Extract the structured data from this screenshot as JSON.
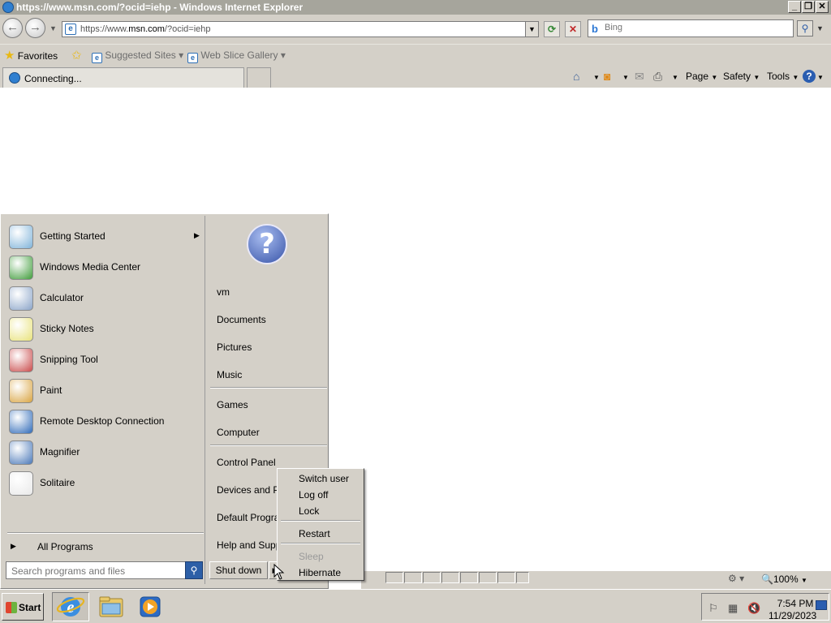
{
  "window": {
    "title": "https://www.msn.com/?ocid=iehp - Windows Internet Explorer",
    "min_label": "_",
    "restore_label": "❐",
    "close_label": "✕"
  },
  "nav": {
    "back_glyph": "←",
    "forward_glyph": "→",
    "address_prefix": "https://www.",
    "address_domain": "msn.com",
    "address_suffix": "/?ocid=iehp",
    "refresh_glyph": "⟳",
    "stop_glyph": "✕",
    "search_placeholder": "Bing",
    "search_logo": "b"
  },
  "favorites_bar": {
    "favorites_label": "Favorites",
    "items": [
      {
        "label": "Suggested Sites ▾"
      },
      {
        "label": "Web Slice Gallery ▾"
      }
    ]
  },
  "tabs": {
    "active_label": "Connecting..."
  },
  "command_bar": {
    "page_label": "Page",
    "safety_label": "Safety",
    "tools_label": "Tools",
    "help_glyph": "?"
  },
  "status_bar": {
    "zoom_label": "100%"
  },
  "start_menu": {
    "programs": [
      {
        "label": "Getting Started",
        "icon": "getting-started-icon",
        "color": "#7fb3d9",
        "has_submenu": true
      },
      {
        "label": "Windows Media Center",
        "icon": "windows-media-center-icon",
        "color": "#3f9c3a"
      },
      {
        "label": "Calculator",
        "icon": "calculator-icon",
        "color": "#8aa4c8"
      },
      {
        "label": "Sticky Notes",
        "icon": "sticky-notes-icon",
        "color": "#e8e27a"
      },
      {
        "label": "Snipping Tool",
        "icon": "snipping-tool-icon",
        "color": "#c94a4a"
      },
      {
        "label": "Paint",
        "icon": "paint-icon",
        "color": "#d9a441"
      },
      {
        "label": "Remote Desktop Connection",
        "icon": "remote-desktop-icon",
        "color": "#2f6ab8"
      },
      {
        "label": "Magnifier",
        "icon": "magnifier-icon",
        "color": "#4a78b8"
      },
      {
        "label": "Solitaire",
        "icon": "solitaire-icon",
        "color": "#e9e9e9"
      }
    ],
    "all_programs_label": "All Programs",
    "search_placeholder": "Search programs and files",
    "user_picture_glyph": "?",
    "places": [
      {
        "label": "vm"
      },
      {
        "label": "Documents"
      },
      {
        "label": "Pictures"
      },
      {
        "label": "Music"
      },
      {
        "label": "Games"
      },
      {
        "label": "Computer"
      },
      {
        "label": "Control Panel"
      },
      {
        "label": "Devices and Pri"
      },
      {
        "label": "Default Prograr"
      },
      {
        "label": "Help and Suppo"
      }
    ],
    "shutdown_label": "Shut down"
  },
  "shutdown_submenu": {
    "items": [
      {
        "label": "Switch user",
        "enabled": true
      },
      {
        "label": "Log off",
        "enabled": true
      },
      {
        "label": "Lock",
        "enabled": true
      },
      {
        "label": "Restart",
        "enabled": true
      },
      {
        "label": "Sleep",
        "enabled": false
      },
      {
        "label": "Hibernate",
        "enabled": true
      }
    ]
  },
  "taskbar": {
    "start_label": "Start",
    "apps": [
      {
        "name": "internet-explorer",
        "active": true
      },
      {
        "name": "windows-explorer",
        "active": false
      },
      {
        "name": "windows-media-player",
        "active": false
      }
    ],
    "clock_time": "7:54 PM",
    "clock_date": "11/29/2023"
  },
  "colors": {
    "chrome": "#d4d0c8",
    "titlebar": "#a6a59c",
    "accent": "#2d5fa7"
  }
}
